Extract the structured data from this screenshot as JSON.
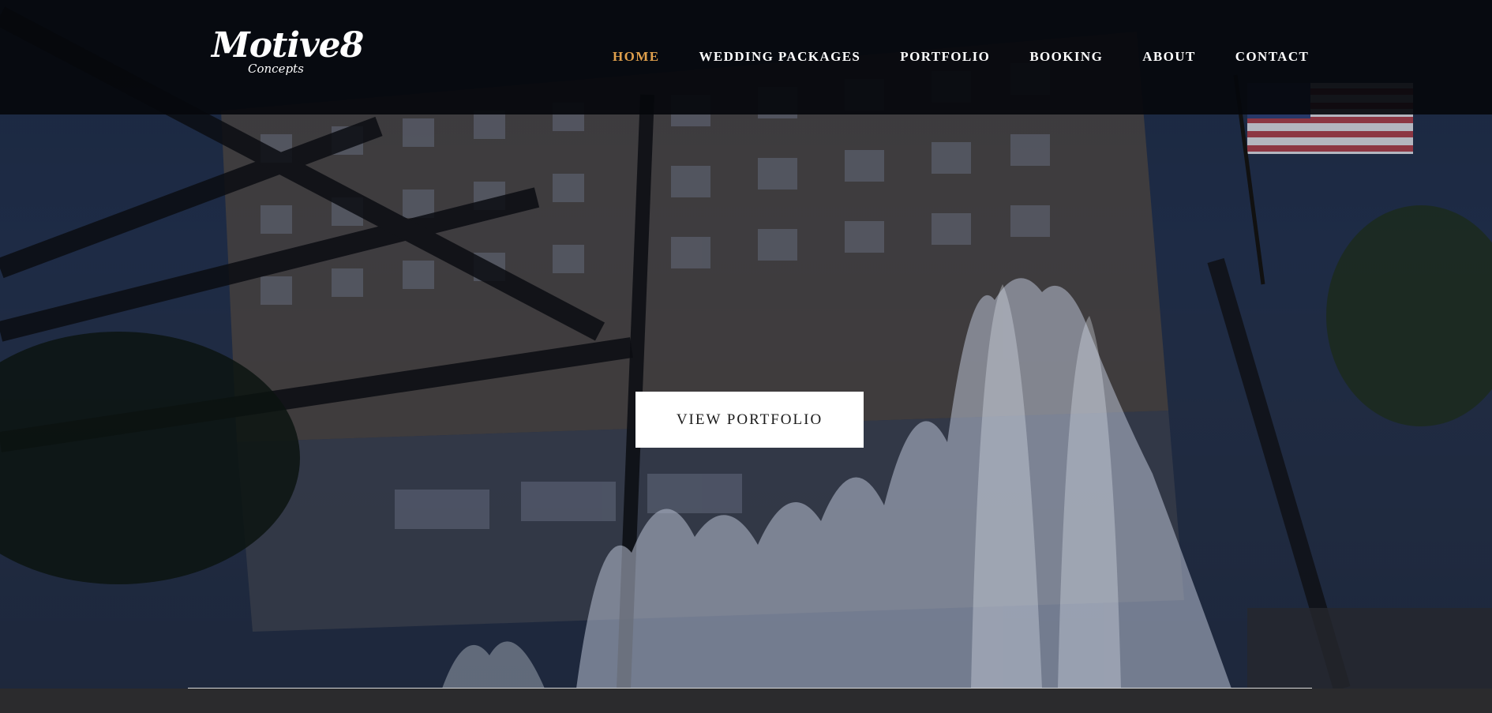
{
  "brand": {
    "name": "Motive8",
    "tagline": "Concepts"
  },
  "nav": {
    "items": [
      {
        "label": "HOME",
        "active": true
      },
      {
        "label": "WEDDING PACKAGES",
        "active": false
      },
      {
        "label": "PORTFOLIO",
        "active": false
      },
      {
        "label": "BOOKING",
        "active": false
      },
      {
        "label": "ABOUT",
        "active": false
      },
      {
        "label": "CONTACT",
        "active": false
      }
    ]
  },
  "hero": {
    "cta_label": "VIEW PORTFOLIO",
    "background": "apartment building with fountain and flag"
  },
  "colors": {
    "accent": "#e0a04c",
    "navbar": "#05080c",
    "button_bg": "#ffffff"
  }
}
